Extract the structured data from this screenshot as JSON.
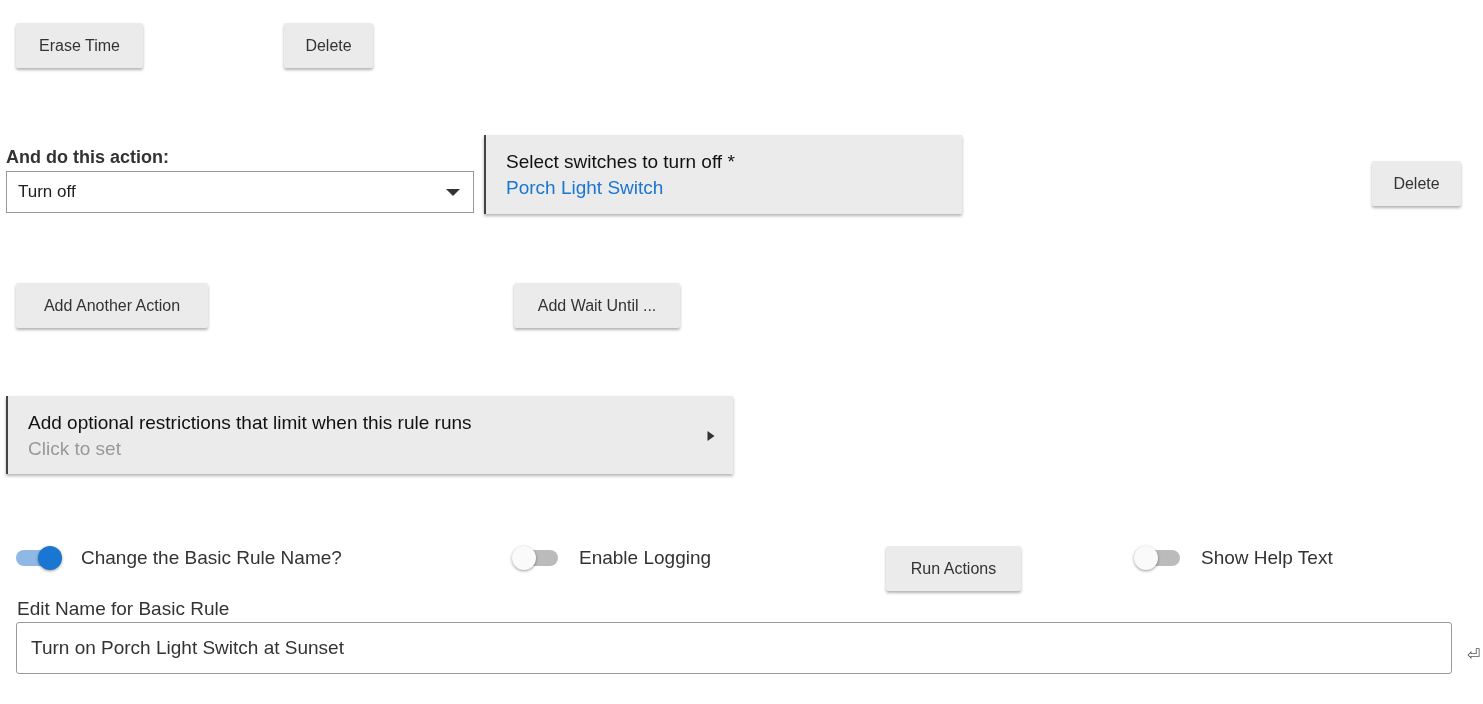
{
  "top_buttons": [
    "Erase Time",
    "Delete"
  ],
  "action": {
    "label": "And do this action:",
    "select": {
      "value": "Turn off"
    },
    "device_picker": {
      "title": "Select switches to turn off *",
      "value": "Porch Light Switch"
    },
    "delete_button": "Delete"
  },
  "action_buttons": [
    "Add Another Action",
    "Add Wait Until ..."
  ],
  "restrictions": {
    "title": "Add optional restrictions that limit when this rule runs",
    "hint": "Click to set"
  },
  "controls": [
    {
      "kind": "toggle",
      "label": "Change the Basic Rule Name?",
      "on": true
    },
    {
      "kind": "toggle",
      "label": "Enable Logging",
      "on": false
    },
    {
      "kind": "button",
      "label": "Run Actions"
    },
    {
      "kind": "toggle",
      "label": "Show Help Text",
      "on": false
    }
  ],
  "name_field": {
    "label": "Edit Name for Basic Rule",
    "value": "Turn on Porch Light Switch at Sunset",
    "return_symbol": "⏎"
  }
}
